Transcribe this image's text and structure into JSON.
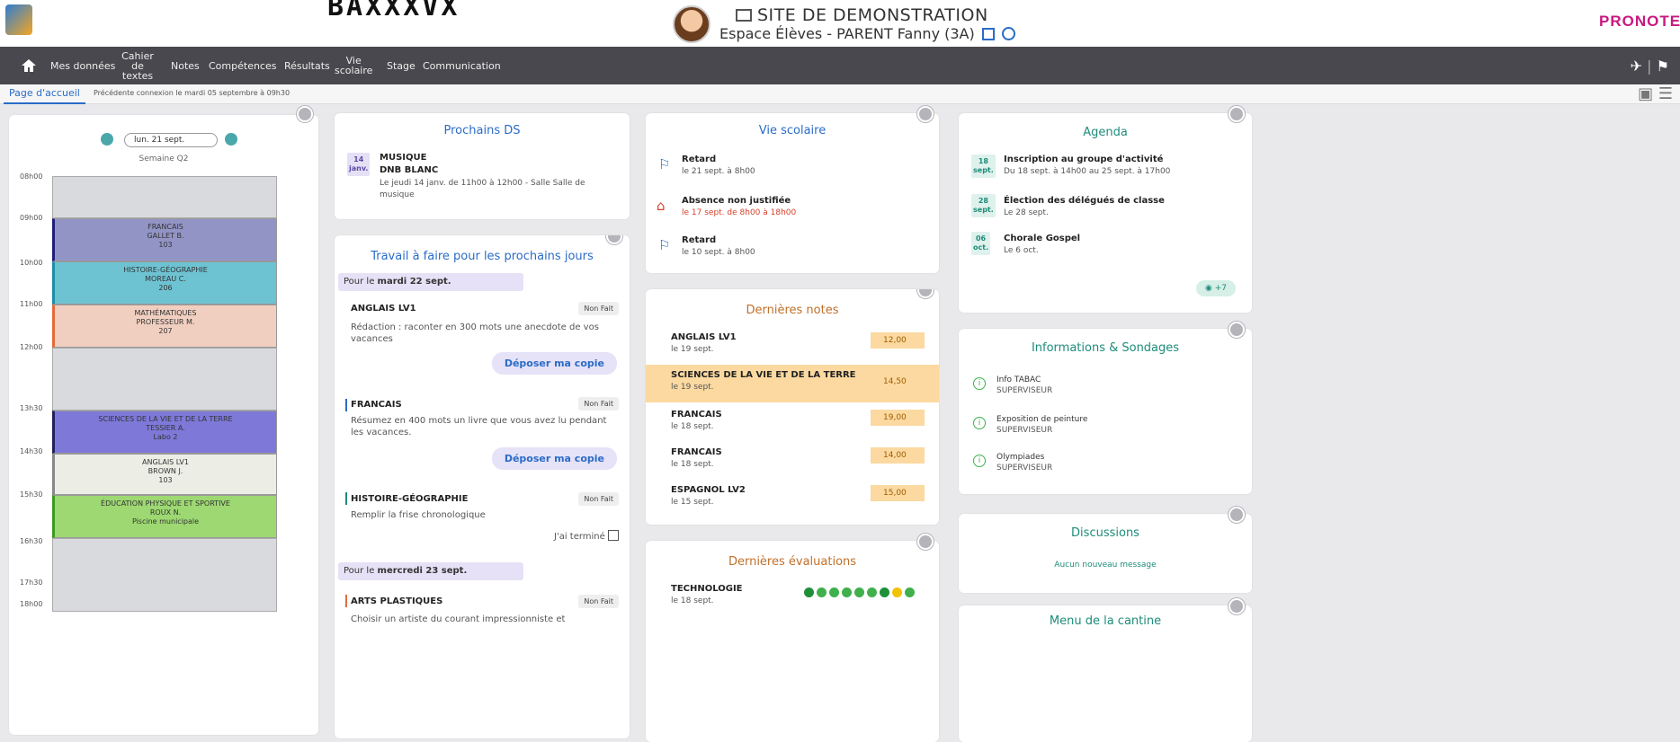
{
  "header": {
    "brand_overlay": "BAXXXVX",
    "site_title": "SITE DE DEMONSTRATION",
    "space": "Espace Élèves - PARENT Fanny (3A)",
    "brand": "PRONOTE"
  },
  "nav": {
    "items": [
      "Mes données",
      "Cahier de textes",
      "Notes",
      "Compétences",
      "Résultats",
      "Vie scolaire",
      "Stage",
      "Communication"
    ]
  },
  "crumb": {
    "tab": "Page d'accueil",
    "last_connection": "Précédente connexion le mardi 05 septembre à 09h30"
  },
  "timetable": {
    "date": "lun. 21 sept.",
    "week": "Semaine Q2",
    "hours": [
      "08h00",
      "09h00",
      "10h00",
      "11h00",
      "12h00",
      "13h30",
      "14h30",
      "15h30",
      "16h30",
      "17h30",
      "18h00"
    ],
    "courses": [
      {
        "subject": "FRANCAIS",
        "teacher": "GALLET B.",
        "room": "103"
      },
      {
        "subject": "HISTOIRE-GÉOGRAPHIE",
        "teacher": "MOREAU C.",
        "room": "206"
      },
      {
        "subject": "MATHÉMATIQUES",
        "teacher": "PROFESSEUR M.",
        "room": "207"
      },
      {
        "subject": "SCIENCES DE LA VIE ET DE LA TERRE",
        "teacher": "TESSIER A.",
        "room": "Labo 2"
      },
      {
        "subject": "ANGLAIS LV1",
        "teacher": "BROWN J.",
        "room": "103"
      },
      {
        "subject": "ÉDUCATION PHYSIQUE ET SPORTIVE",
        "teacher": "ROUX N.",
        "room": "Piscine municipale"
      }
    ]
  },
  "ds": {
    "title": "Prochains DS",
    "date_day": "14",
    "date_month": "janv.",
    "subject": "MUSIQUE",
    "type": "DNB BLANC",
    "detail": "Le jeudi 14 janv. de 11h00 à 12h00 - Salle Salle de musique"
  },
  "homework": {
    "title": "Travail à faire pour les prochains jours",
    "pour_prefix": "Pour le",
    "day1": "mardi 22 sept.",
    "day2": "mercredi 23 sept.",
    "status": "Non Fait",
    "submit": "Déposer ma copie",
    "done_label": "J'ai terminé",
    "items": [
      {
        "subject": "ANGLAIS LV1",
        "text": "Rédaction : raconter en 300 mots une anecdote de vos vacances"
      },
      {
        "subject": "FRANCAIS",
        "text": "Résumez en 400 mots un livre que vous avez lu pendant les vacances."
      },
      {
        "subject": "HISTOIRE-GÉOGRAPHIE",
        "text": "Remplir la frise chronologique"
      },
      {
        "subject": "ARTS PLASTIQUES",
        "text": "Choisir un artiste du courant impressionniste et"
      }
    ]
  },
  "vie": {
    "title": "Vie scolaire",
    "items": [
      {
        "label": "Retard",
        "date": "le 21 sept. à 8h00"
      },
      {
        "label": "Absence non justifiée",
        "date": "le 17 sept. de 8h00 à 18h00"
      },
      {
        "label": "Retard",
        "date": "le 10 sept. à 8h00"
      }
    ]
  },
  "notes": {
    "title": "Dernières notes",
    "items": [
      {
        "subject": "ANGLAIS LV1",
        "date": "le 19 sept.",
        "value": "12,00"
      },
      {
        "subject": "SCIENCES DE LA VIE ET DE LA TERRE",
        "date": "le 19 sept.",
        "value": "14,50"
      },
      {
        "subject": "FRANCAIS",
        "date": "le 18 sept.",
        "value": "19,00"
      },
      {
        "subject": "FRANCAIS",
        "date": "le 18 sept.",
        "value": "14,00"
      },
      {
        "subject": "ESPAGNOL LV2",
        "date": "le 15 sept.",
        "value": "15,00"
      }
    ]
  },
  "evals": {
    "title": "Dernières évaluations",
    "subject": "TECHNOLOGIE",
    "date": "le 18 sept.",
    "dots": [
      "#1f8f3a",
      "#3fb04c",
      "#3fb04c",
      "#3fb04c",
      "#3fb04c",
      "#3fb04c",
      "#1f8f3a",
      "#f2c200",
      "#3fb04c"
    ]
  },
  "agenda": {
    "title": "Agenda",
    "more": "+7",
    "items": [
      {
        "day": "18",
        "month": "sept.",
        "title": "Inscription au groupe d'activité",
        "detail": "Du 18 sept. à 14h00 au 25 sept. à 17h00"
      },
      {
        "day": "28",
        "month": "sept.",
        "title": "Élection des délégués de classe",
        "detail": "Le 28 sept."
      },
      {
        "day": "06",
        "month": "oct.",
        "title": "Chorale Gospel",
        "detail": "Le 6 oct."
      }
    ]
  },
  "infos": {
    "title": "Informations & Sondages",
    "items": [
      {
        "title": "Info TABAC",
        "author": "SUPERVISEUR"
      },
      {
        "title": "Exposition de peinture",
        "author": "SUPERVISEUR"
      },
      {
        "title": "Olympiades",
        "author": "SUPERVISEUR"
      }
    ]
  },
  "discussions": {
    "title": "Discussions",
    "empty": "Aucun nouveau message"
  },
  "cantine": {
    "title": "Menu de la cantine"
  },
  "colors": {
    "accent": "#2a6cc7",
    "nav": "#48484e",
    "teal": "#1e8c7a",
    "brand": "#c8197e"
  }
}
